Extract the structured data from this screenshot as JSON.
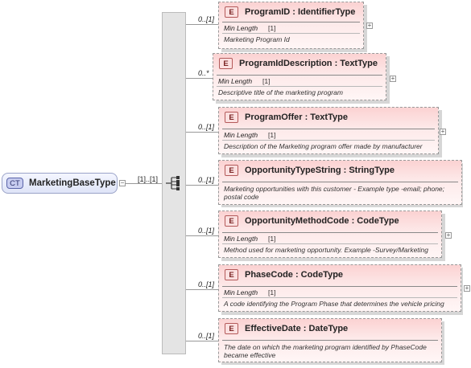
{
  "complex_type": {
    "badge": "CT",
    "name": "MarketingBaseType"
  },
  "sequence_cardinality": "[1]..[1]",
  "elements": [
    {
      "badge": "E",
      "title": "ProgramID : IdentifierType",
      "cardinality": "0..[1]",
      "facet_label": "Min Length",
      "facet_value": "[1]",
      "doc": "Marketing Program Id"
    },
    {
      "badge": "E",
      "title": "ProgramIdDescription : TextType",
      "cardinality": "0..*",
      "facet_label": "Min Length",
      "facet_value": "[1]",
      "doc": "Descriptive title of the marketing program"
    },
    {
      "badge": "E",
      "title": "ProgramOffer : TextType",
      "cardinality": "0..[1]",
      "facet_label": "Min Length",
      "facet_value": "[1]",
      "doc": "Description of the Marketing program offer made by manufacturer"
    },
    {
      "badge": "E",
      "title": "OpportunityTypeString : StringType",
      "cardinality": "0..[1]",
      "facet_label": "",
      "facet_value": "",
      "doc": "Marketing opportunities with this customer - Example type -email; phone; postal code"
    },
    {
      "badge": "E",
      "title": "OpportunityMethodCode : CodeType",
      "cardinality": "0..[1]",
      "facet_label": "Min Length",
      "facet_value": "[1]",
      "doc": "Method used for marketing opportunity. Example -Survey/Marketing"
    },
    {
      "badge": "E",
      "title": "PhaseCode : CodeType",
      "cardinality": "0..[1]",
      "facet_label": "Min Length",
      "facet_value": "[1]",
      "doc": "A code identifying the Program Phase that determines the vehicle pricing"
    },
    {
      "badge": "E",
      "title": "EffectiveDate : DateType",
      "cardinality": "0..[1]",
      "facet_label": "",
      "facet_value": "",
      "doc": "The date on which the marketing program identified by PhaseCode became effective"
    }
  ]
}
